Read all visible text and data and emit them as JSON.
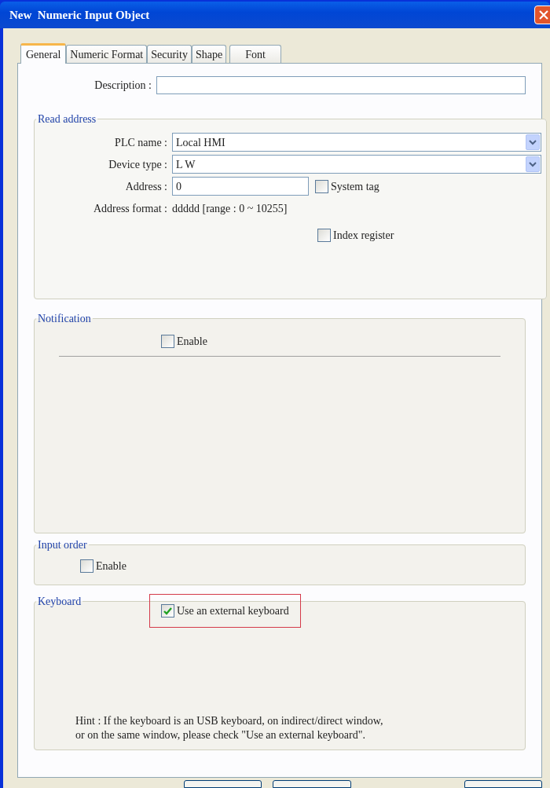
{
  "window": {
    "title": "New  Numeric Input Object"
  },
  "tabs": [
    {
      "label": "General",
      "selected": true
    },
    {
      "label": "Numeric Format",
      "selected": false
    },
    {
      "label": "Security",
      "selected": false
    },
    {
      "label": "Shape",
      "selected": false
    },
    {
      "label": "Font",
      "selected": false
    }
  ],
  "description": {
    "label": "Description :"
  },
  "read_address": {
    "title": "Read address",
    "plc_name": {
      "label": "PLC name :",
      "value": "Local HMI"
    },
    "device_type": {
      "label": "Device type :",
      "value": "L W"
    },
    "address": {
      "label": "Address :",
      "value": "0"
    },
    "system_tag": {
      "label": "System tag",
      "checked": false
    },
    "address_format": {
      "label": "Address format :",
      "value": "ddddd [range : 0 ~ 10255]"
    },
    "index_register": {
      "label": "Index register",
      "checked": false
    }
  },
  "notification": {
    "title": "Notification",
    "enable": {
      "label": "Enable",
      "checked": false
    }
  },
  "input_order": {
    "title": "Input order",
    "enable": {
      "label": "Enable",
      "checked": false
    }
  },
  "keyboard": {
    "title": "Keyboard",
    "external": {
      "label": "Use an external keyboard",
      "checked": true,
      "highlighted": true
    },
    "hint": [
      "Hint : If the keyboard is an USB keyboard, on indirect/direct window,",
      "or on the same window, please check \"Use an external keyboard\"."
    ]
  }
}
